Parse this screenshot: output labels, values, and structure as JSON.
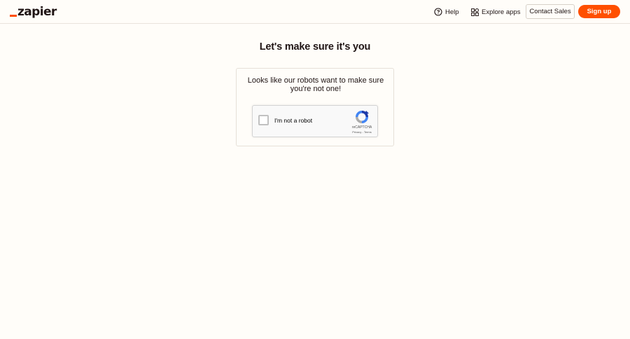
{
  "header": {
    "logo_text": "zapier",
    "help_label": "Help",
    "explore_label": "Explore apps",
    "contact_label": "Contact Sales",
    "signup_label": "Sign up",
    "brand_color": "#ff4f00"
  },
  "main": {
    "title": "Let's make sure it's you",
    "message": "Looks like our robots want to make sure you're not one!"
  },
  "recaptcha": {
    "label": "I'm not a robot",
    "brand": "reCAPTCHA",
    "privacy_link": "Privacy",
    "separator": " - ",
    "terms_link": "Terms"
  },
  "icons": {
    "help": "help-circle-icon",
    "explore": "apps-grid-icon",
    "recaptcha": "recaptcha-logo-icon"
  }
}
